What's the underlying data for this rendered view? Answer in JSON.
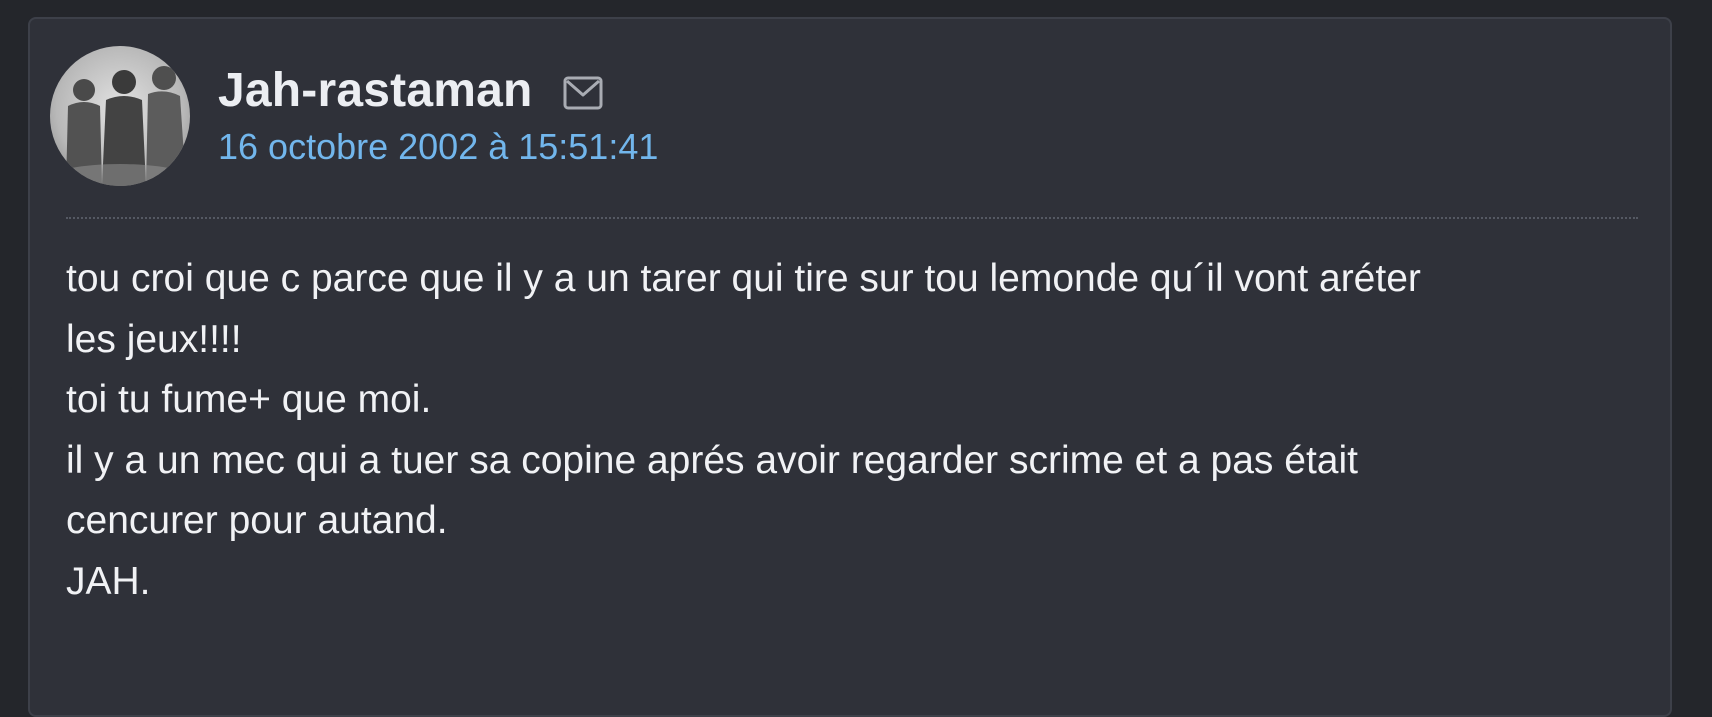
{
  "post": {
    "author": "Jah-rastaman",
    "mail_icon": "envelope-icon",
    "date": "16 octobre 2002 à 15:51:41",
    "body_lines": [
      "tou croi que c parce que il y a un tarer qui tire sur tou lemonde qu´il vont aréter",
      "les jeux!!!!",
      "toi tu fume+ que moi.",
      "il y a un mec qui a tuer sa copine aprés avoir regarder scrime et a pas était",
      "cencurer pour autand.",
      "JAH."
    ]
  },
  "colors": {
    "page_background": "#24262b",
    "card_background": "#2f3139",
    "author_text": "#eceef2",
    "date_link": "#72b6ec",
    "body_text": "#f1f2f5"
  }
}
